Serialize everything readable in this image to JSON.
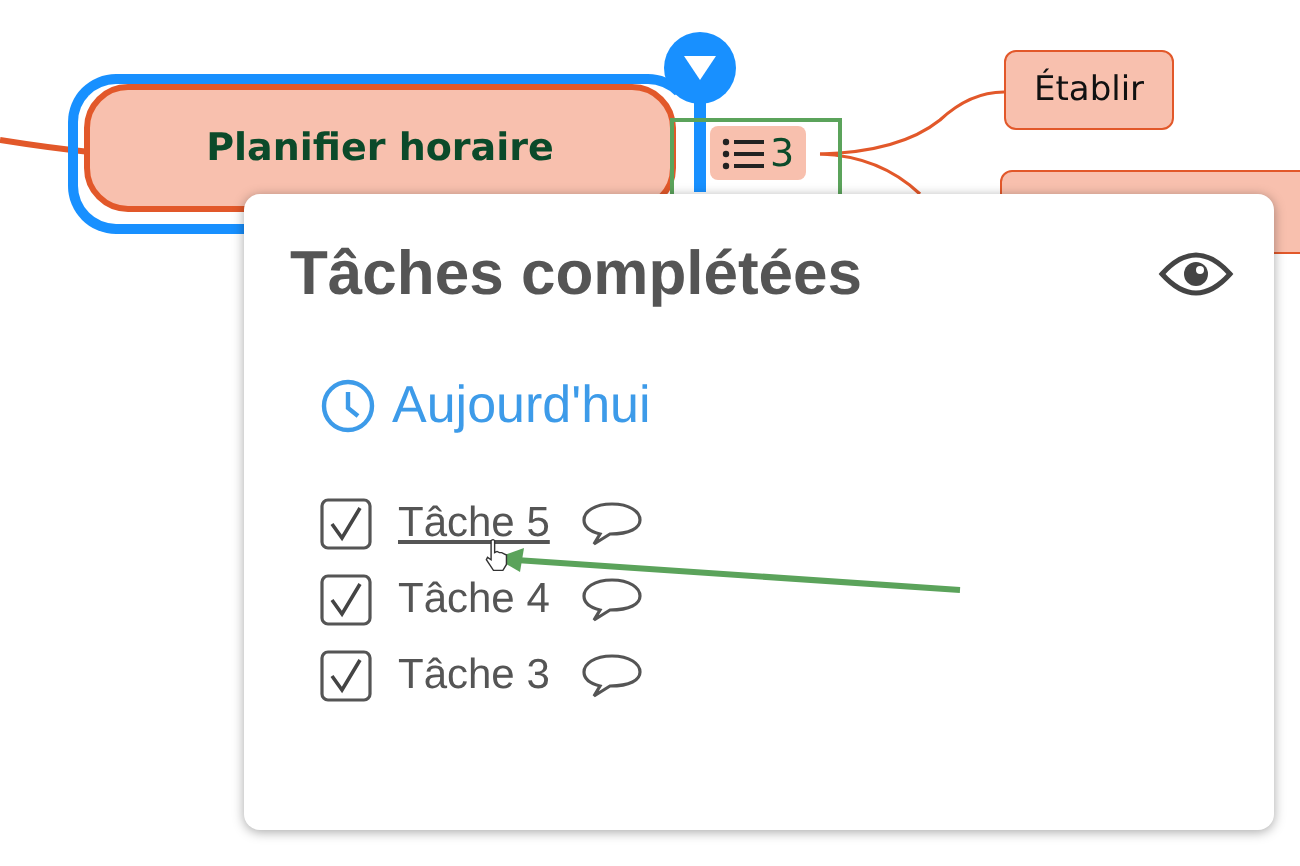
{
  "node": {
    "title": "Planifier horaire",
    "selected": true,
    "task_count": "3"
  },
  "branches": [
    {
      "label": "Établir"
    }
  ],
  "popup": {
    "title": "Tâches complétées",
    "section": "Aujourd'hui",
    "tasks": [
      {
        "label": "Tâche 5",
        "checked": true,
        "hovered": true
      },
      {
        "label": "Tâche 4",
        "checked": true,
        "hovered": false
      },
      {
        "label": "Tâche 3",
        "checked": true,
        "hovered": false
      }
    ]
  }
}
